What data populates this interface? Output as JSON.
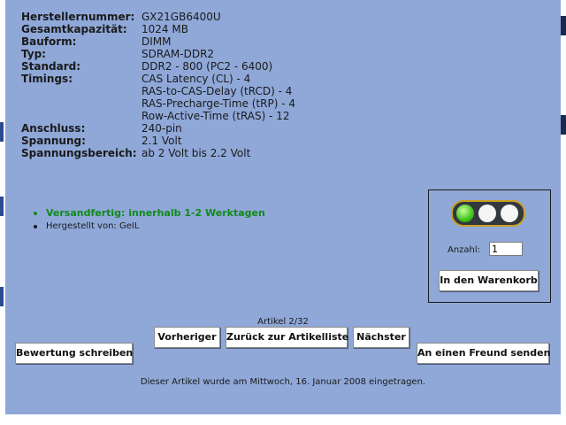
{
  "specs": [
    {
      "label": "Herstellernummer:",
      "value": "GX21GB6400U"
    },
    {
      "label": "Gesamtkapazität:",
      "value": "1024 MB"
    },
    {
      "label": "Bauform:",
      "value": "DIMM"
    },
    {
      "label": "Typ:",
      "value": "SDRAM-DDR2"
    },
    {
      "label": "Standard:",
      "value": "DDR2 - 800 (PC2 - 6400)"
    },
    {
      "label": "Timings:",
      "value": "CAS Latency (CL) - 4"
    },
    {
      "label": "",
      "value": "RAS-to-CAS-Delay (tRCD) - 4"
    },
    {
      "label": "",
      "value": "RAS-Precharge-Time (tRP) - 4"
    },
    {
      "label": "",
      "value": "Row-Active-Time (tRAS) - 12"
    },
    {
      "label": "Anschluss:",
      "value": "240-pin"
    },
    {
      "label": "Spannung:",
      "value": "2.1 Volt"
    },
    {
      "label": "Spannungsbereich:",
      "value": "ab 2 Volt bis 2.2 Volt"
    }
  ],
  "info": {
    "shipping": "Versandfertig: innerhalb 1-2 Werktagen",
    "manufacturer": "Hergestellt von: GeIL"
  },
  "availability": {
    "light": "green",
    "colors": {
      "green": "#3fc21a",
      "off": "#f6f6f6",
      "frame": "#c9a020"
    }
  },
  "cart": {
    "qty_label": "Anzahl:",
    "qty_value": "1",
    "add_button": "In den Warenkorb"
  },
  "nav": {
    "counter": "Artikel 2/32",
    "prev": "Vorheriger",
    "back": "Zurück zur Artikelliste",
    "next": "Nächster"
  },
  "actions": {
    "review": "Bewertung schreiben",
    "send_friend": "An einen Freund senden"
  },
  "footer": "Dieser Artikel wurde am Mittwoch, 16. Januar 2008 eingetragen.",
  "theme": {
    "panel": "#8fa8d8",
    "accent": "#118a1a"
  }
}
